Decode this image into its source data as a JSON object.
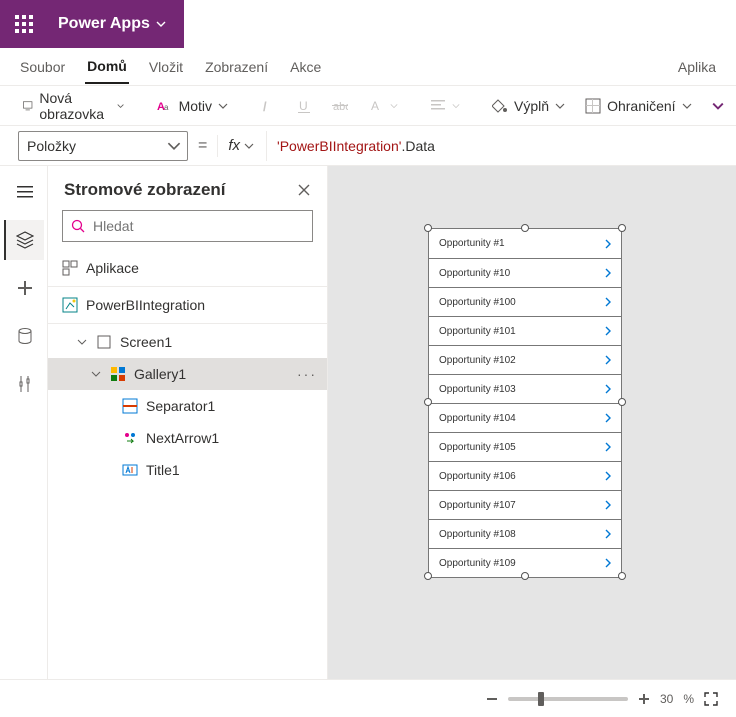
{
  "header": {
    "app_name": "Power Apps"
  },
  "menu": {
    "file": "Soubor",
    "home": "Domů",
    "insert": "Vložit",
    "view": "Zobrazení",
    "actions": "Akce",
    "right": "Aplika"
  },
  "toolbar": {
    "new_screen": "Nová obrazovka",
    "theme": "Motiv",
    "fill": "Výplň",
    "border": "Ohraničení"
  },
  "formula": {
    "property": "Položky",
    "equals": "=",
    "fx": "fx",
    "value_str": "'PowerBIIntegration'",
    "value_prop": ".Data"
  },
  "tree": {
    "title": "Stromové zobrazení",
    "search_placeholder": "Hledat",
    "app": "Aplikace",
    "pbi": "PowerBIIntegration",
    "screen1": "Screen1",
    "gallery1": "Gallery1",
    "separator1": "Separator1",
    "nextarrow1": "NextArrow1",
    "title1": "Title1"
  },
  "gallery_items": [
    "Opportunity #1",
    "Opportunity #10",
    "Opportunity #100",
    "Opportunity #101",
    "Opportunity #102",
    "Opportunity #103",
    "Opportunity #104",
    "Opportunity #105",
    "Opportunity #106",
    "Opportunity #107",
    "Opportunity #108",
    "Opportunity #109"
  ],
  "zoom": {
    "percent": "30",
    "suffix": "%"
  }
}
